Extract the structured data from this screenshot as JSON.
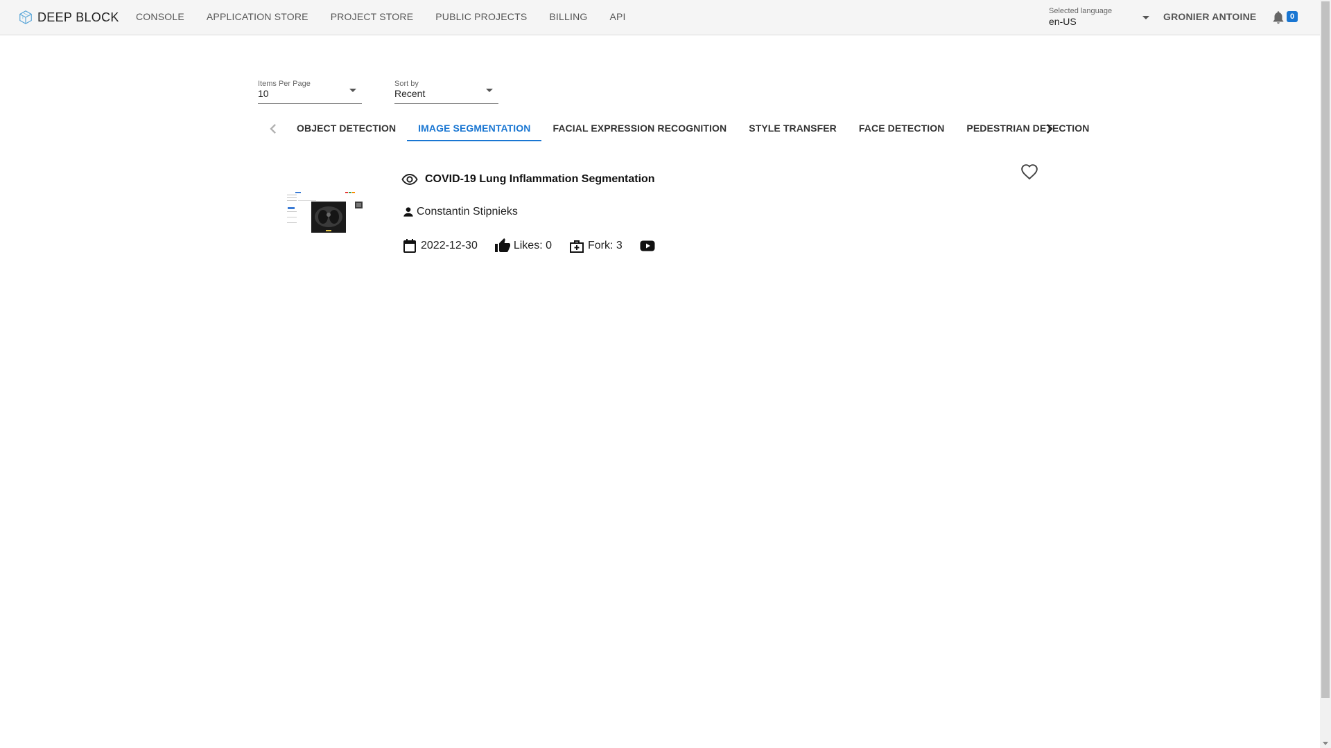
{
  "header": {
    "brand": "DEEP BLOCK",
    "nav": [
      "CONSOLE",
      "APPLICATION STORE",
      "PROJECT STORE",
      "PUBLIC PROJECTS",
      "BILLING",
      "API"
    ],
    "language_label": "Selected language",
    "language_value": "en-US",
    "user_name": "GRONIER ANTOINE",
    "notification_count": "0",
    "accent_color": "#1976d2"
  },
  "filters": {
    "items_per_page_label": "Items Per Page",
    "items_per_page_value": "10",
    "sort_label": "Sort by",
    "sort_value": "Recent"
  },
  "tabs": {
    "items": [
      "OBJECT DETECTION",
      "IMAGE SEGMENTATION",
      "FACIAL EXPRESSION RECOGNITION",
      "STYLE TRANSFER",
      "FACE DETECTION",
      "PEDESTRIAN DETECTION"
    ],
    "active": "IMAGE SEGMENTATION"
  },
  "project": {
    "title": "COVID-19 Lung Inflammation Segmentation",
    "author": "Constantin Stipnieks",
    "date": "2022-12-30",
    "likes": "Likes: 0",
    "forks": "Fork: 3",
    "icons": [
      "eye-icon",
      "person-icon",
      "calendar-icon",
      "thumb-up-icon",
      "fork-icon",
      "youtube-icon",
      "heart-icon"
    ]
  }
}
